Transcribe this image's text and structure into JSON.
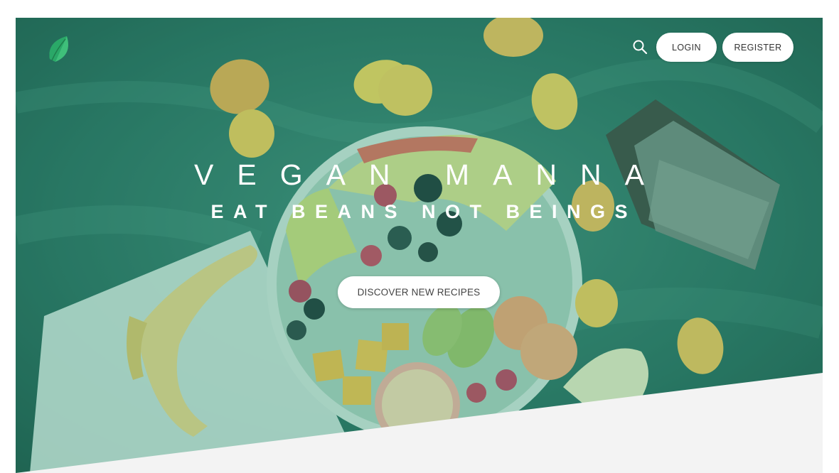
{
  "header": {
    "logo_icon": "leaf-icon",
    "search_icon": "search-icon",
    "login_label": "LOGIN",
    "register_label": "REGISTER"
  },
  "hero": {
    "title": "VEGAN MANNA",
    "subtitle": "EAT BEANS NOT BEINGS",
    "cta_label": "DISCOVER NEW RECIPES",
    "overlay_color": "#2b8a6e",
    "section_below_color": "#f3f3f3"
  }
}
